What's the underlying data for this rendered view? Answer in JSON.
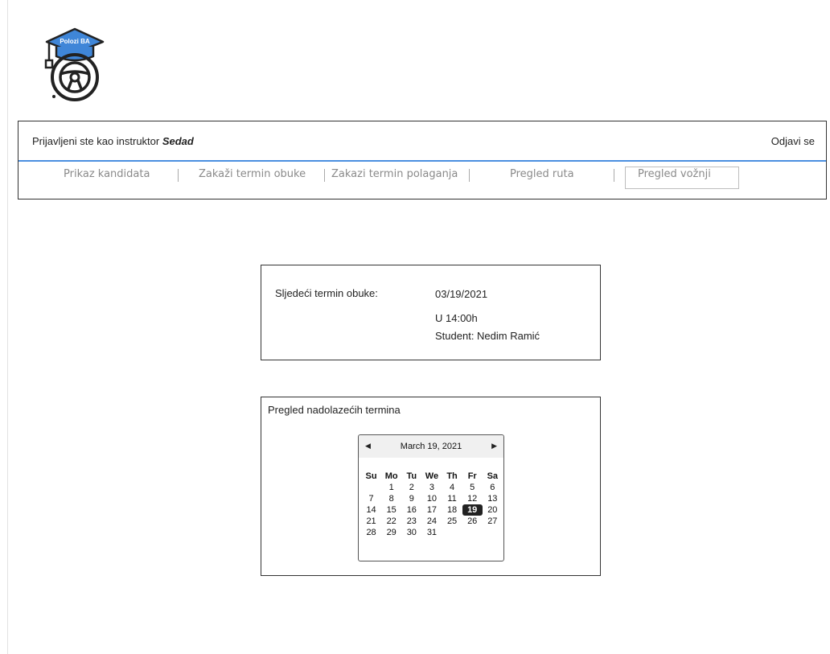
{
  "logo": {
    "text": "Polozi BA",
    "icon": "graduation-cap-steering-wheel-icon"
  },
  "header": {
    "login_prefix": "Prijavljeni ste kao instruktor ",
    "user_name": "Sedad",
    "logout_label": "Odjavi se",
    "accent_color": "#4a8fe0"
  },
  "nav": {
    "items": [
      {
        "label": "Prikaz kandidata"
      },
      {
        "label": "Zakaži termin obuke"
      },
      {
        "label": "Zakazi termin polaganja"
      },
      {
        "label": "Pregled ruta"
      },
      {
        "label": "Pregled vožnji",
        "active": true
      }
    ]
  },
  "next_session": {
    "label": "Sljedeći termin obuke:",
    "date": "03/19/2021",
    "time": "U 14:00h",
    "student": "Student: Nedim Ramić"
  },
  "upcoming": {
    "title": "Pregled nadolazećih termina",
    "calendar": {
      "title": "March 19, 2021",
      "prev_icon": "triangle-left-icon",
      "next_icon": "triangle-right-icon",
      "weekdays": [
        "Su",
        "Mo",
        "Tu",
        "We",
        "Th",
        "Fr",
        "Sa"
      ],
      "weeks": [
        [
          "",
          "1",
          "2",
          "3",
          "4",
          "5",
          "6"
        ],
        [
          "7",
          "8",
          "9",
          "10",
          "11",
          "12",
          "13"
        ],
        [
          "14",
          "15",
          "16",
          "17",
          "18",
          "19",
          "20"
        ],
        [
          "21",
          "22",
          "23",
          "24",
          "25",
          "26",
          "27"
        ],
        [
          "28",
          "29",
          "30",
          "31",
          "",
          "",
          ""
        ]
      ],
      "selected_day": "19"
    }
  }
}
